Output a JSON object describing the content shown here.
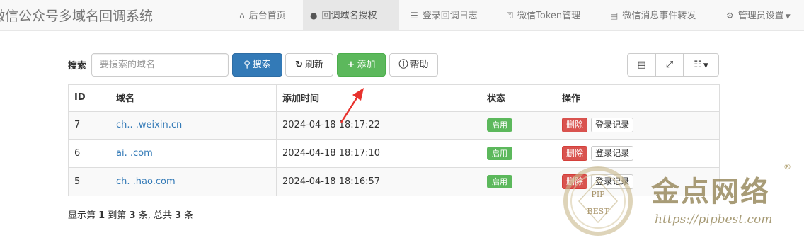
{
  "navbar": {
    "brand": "微信公众号多域名回调系统",
    "items": [
      {
        "label": "后台首页",
        "icon": "home-icon"
      },
      {
        "label": "回调域名授权",
        "icon": "globe-icon"
      },
      {
        "label": "登录回调日志",
        "icon": "list-icon"
      },
      {
        "label": "微信Token管理",
        "icon": "key-icon"
      },
      {
        "label": "微信消息事件转发",
        "icon": "hdd-icon"
      },
      {
        "label": "管理员设置",
        "icon": "cog-icon"
      }
    ]
  },
  "toolbar": {
    "search_label": "搜索",
    "search_placeholder": "要搜索的域名",
    "search_button": "搜索",
    "refresh_button": "刷新",
    "add_button": "添加",
    "help_button": "帮助"
  },
  "table": {
    "columns": [
      "ID",
      "域名",
      "添加时间",
      "状态",
      "操作"
    ],
    "rows": [
      {
        "id": "7",
        "domain": "ch.. .weixin.cn",
        "added": "2024-04-18 18:17:22",
        "status": "启用",
        "delete": "删除",
        "log": "登录记录"
      },
      {
        "id": "6",
        "domain": "ai. .com",
        "added": "2024-04-18 18:17:10",
        "status": "启用",
        "delete": "删除",
        "log": "登录记录"
      },
      {
        "id": "5",
        "domain": "ch. .hao.com",
        "added": "2024-04-18 18:16:57",
        "status": "启用",
        "delete": "删除",
        "log": "登录记录"
      }
    ]
  },
  "pagination": {
    "prefix": "显示第",
    "start": "1",
    "to": "到第",
    "end": "3",
    "mid": "条, 总共",
    "total": "3",
    "suffix": "条"
  },
  "watermark": {
    "brand": "金点网络",
    "url": "https://pipbest.com",
    "seal_top": "PIP",
    "seal_bottom": "BEST",
    "reg": "®"
  },
  "colors": {
    "primary": "#337ab7",
    "success": "#5cb85c",
    "danger": "#d9534f",
    "arrow": "#e8322d"
  }
}
